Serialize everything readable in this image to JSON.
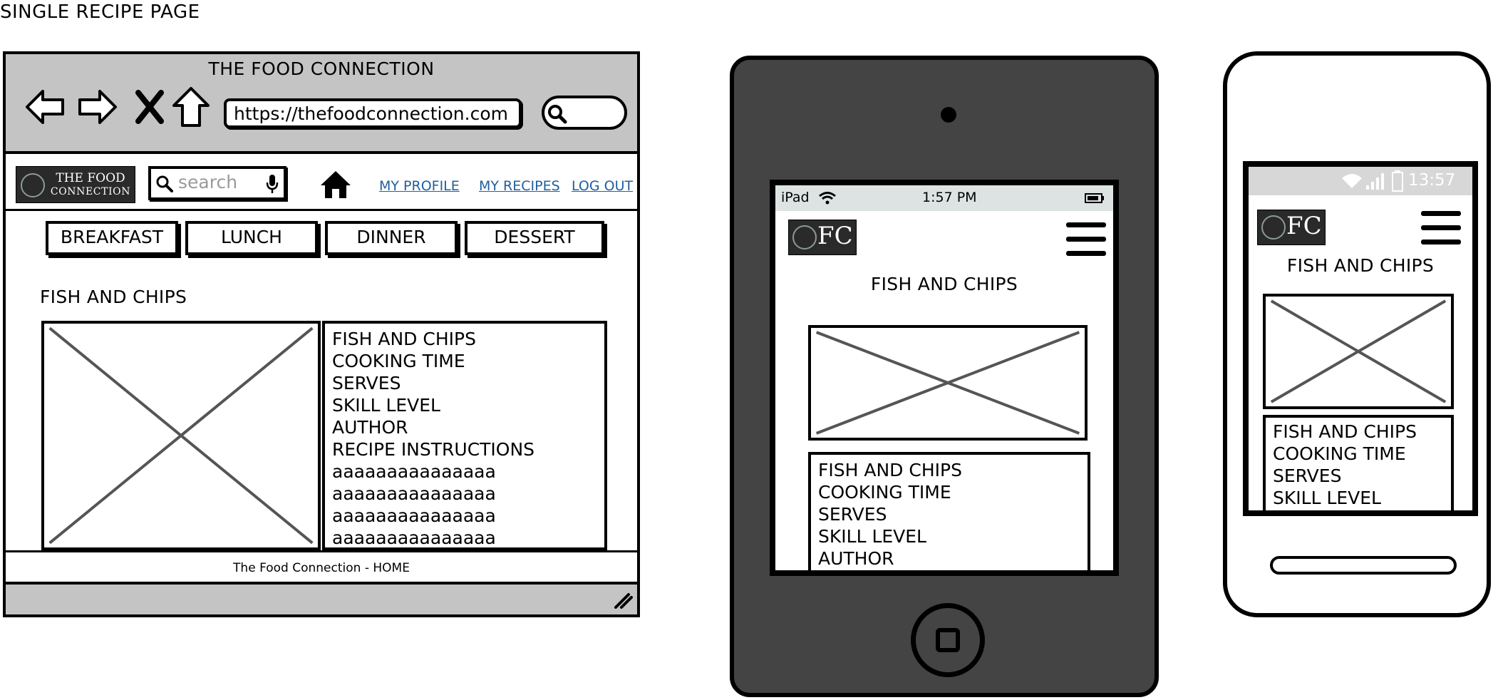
{
  "page": {
    "title": "SINGLE RECIPE PAGE"
  },
  "desktop": {
    "window_title": "THE FOOD CONNECTION",
    "url": "https://thefoodconnection.com",
    "logo": {
      "line1": "THE FOOD",
      "line2": "CONNECTION"
    },
    "search_placeholder": "search",
    "nav_links": [
      "MY PROFILE",
      "MY RECIPES",
      "LOG OUT"
    ],
    "categories": [
      "BREAKFAST",
      "LUNCH",
      "DINNER",
      "DESSERT"
    ],
    "recipe_heading": "FISH AND CHIPS",
    "details": [
      "FISH AND CHIPS",
      "COOKING TIME",
      "SERVES",
      "SKILL LEVEL",
      "AUTHOR",
      "RECIPE INSTRUCTIONS",
      "aaaaaaaaaaaaaaa",
      "aaaaaaaaaaaaaaa",
      "aaaaaaaaaaaaaaa",
      "aaaaaaaaaaaaaaa"
    ],
    "footer": "The Food Connection  - HOME"
  },
  "tablet": {
    "status": {
      "device": "iPad",
      "time": "1:57 PM"
    },
    "logo_text": "FC",
    "heading": "FISH AND CHIPS",
    "details": [
      "FISH AND CHIPS",
      "COOKING TIME",
      "SERVES",
      "SKILL LEVEL",
      "AUTHOR"
    ]
  },
  "phone": {
    "status": {
      "time": "13:57"
    },
    "logo_text": "FC",
    "heading": "FISH AND CHIPS",
    "details": [
      "FISH AND CHIPS",
      "COOKING TIME",
      "SERVES",
      "SKILL LEVEL"
    ]
  },
  "colors": {
    "chrome": "#c4c4c4",
    "link": "#1f5f9f",
    "tablet_body": "#444444",
    "logo_bg": "#2a2a2a"
  }
}
